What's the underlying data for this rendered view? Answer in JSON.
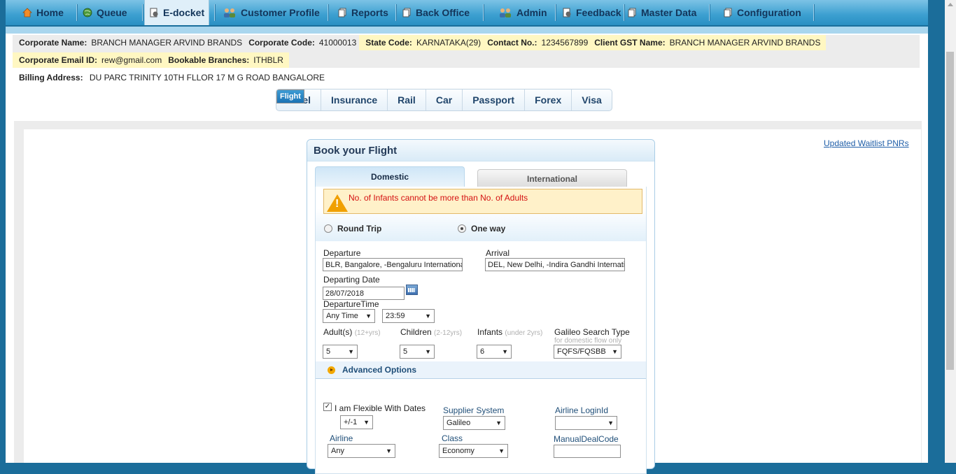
{
  "nav": {
    "items": [
      {
        "label": "Home",
        "icon": "home-icon"
      },
      {
        "label": "Queue",
        "icon": "globe-icon"
      },
      {
        "label": "E-docket",
        "icon": "docket-icon"
      },
      {
        "label": "Customer Profile",
        "icon": "users-icon"
      },
      {
        "label": "Reports",
        "icon": "document-icon"
      },
      {
        "label": "Back Office",
        "icon": "document-icon"
      },
      {
        "label": "Admin",
        "icon": "users-icon"
      },
      {
        "label": "Feedback",
        "icon": "feedback-icon"
      },
      {
        "label": "Master Data",
        "icon": "document-icon"
      },
      {
        "label": "Configuration",
        "icon": "document-icon"
      }
    ],
    "active": "E-docket"
  },
  "corporate": {
    "name_label": "Corporate Name:",
    "name": "BRANCH MANAGER ARVIND BRANDS",
    "code_label": "Corporate Code:",
    "code": "41000013",
    "state_label": "State Code:",
    "state": "KARNATAKA(29)",
    "contact_label": "Contact No.:",
    "contact": "1234567899",
    "gst_label": "Client GST Name:",
    "gst": "BRANCH MANAGER ARVIND BRANDS",
    "email_label": "Corporate Email ID:",
    "email": "rew@gmail.com",
    "branches_label": "Bookable Branches:",
    "branches": "ITHBLR",
    "billing_label": "Billing Address:",
    "billing": "DU PARC TRINITY 10TH FLLOR 17 M G ROAD BANGALORE"
  },
  "product_tabs": [
    "Flight",
    "Hotel",
    "Insurance",
    "Rail",
    "Car",
    "Passport",
    "Forex",
    "Visa"
  ],
  "selected_tab": "Flight",
  "waitlist_link": "Updated Waitlist PNRs",
  "book": {
    "title": "Book your Flight",
    "tab_domestic": "Domestic",
    "tab_international": "International",
    "warning": "No. of Infants cannot be more than No. of Adults",
    "trip_round": "Round Trip",
    "trip_oneway": "One way",
    "selected_trip": "One way",
    "departure_label": "Departure",
    "departure_value": "BLR, Bangalore, -Bengaluru Internationa",
    "arrival_label": "Arrival",
    "arrival_value": "DEL, New Delhi, -Indira Gandhi Internati",
    "date_label": "Departing Date",
    "date_value": "28/07/2018",
    "time_label": "DepartureTime",
    "time_value": "Any Time",
    "time_value2": "23:59",
    "adults_label": "Adult(s)",
    "adults_hint": "(12+yrs)",
    "adults_value": "5",
    "children_label": "Children",
    "children_hint": "(2-12yrs)",
    "children_value": "5",
    "infants_label": "Infants",
    "infants_hint": "(under 2yrs)",
    "infants_value": "6",
    "galileo_label": "Galileo Search Type",
    "galileo_hint": "for domestic flow only",
    "galileo_value": "FQFS/FQSBB",
    "advanced": "Advanced Options",
    "flexible_label": "I am Flexible With Dates",
    "flexible_checked": true,
    "flex_value": "+/-1",
    "supplier_label": "Supplier System",
    "supplier_value": "Galileo",
    "airline_login_label": "Airline LoginId",
    "airline_login_value": "",
    "airline_label": "Airline",
    "airline_value": "Any",
    "class_label": "Class",
    "class_value": "Economy",
    "manual_label": "ManualDealCode",
    "manual_value": ""
  },
  "colors": {
    "nav": "#3b9fd0",
    "accent": "#1b73b5",
    "warning_text": "#d41111",
    "warning_bg": "#fff1c9"
  }
}
